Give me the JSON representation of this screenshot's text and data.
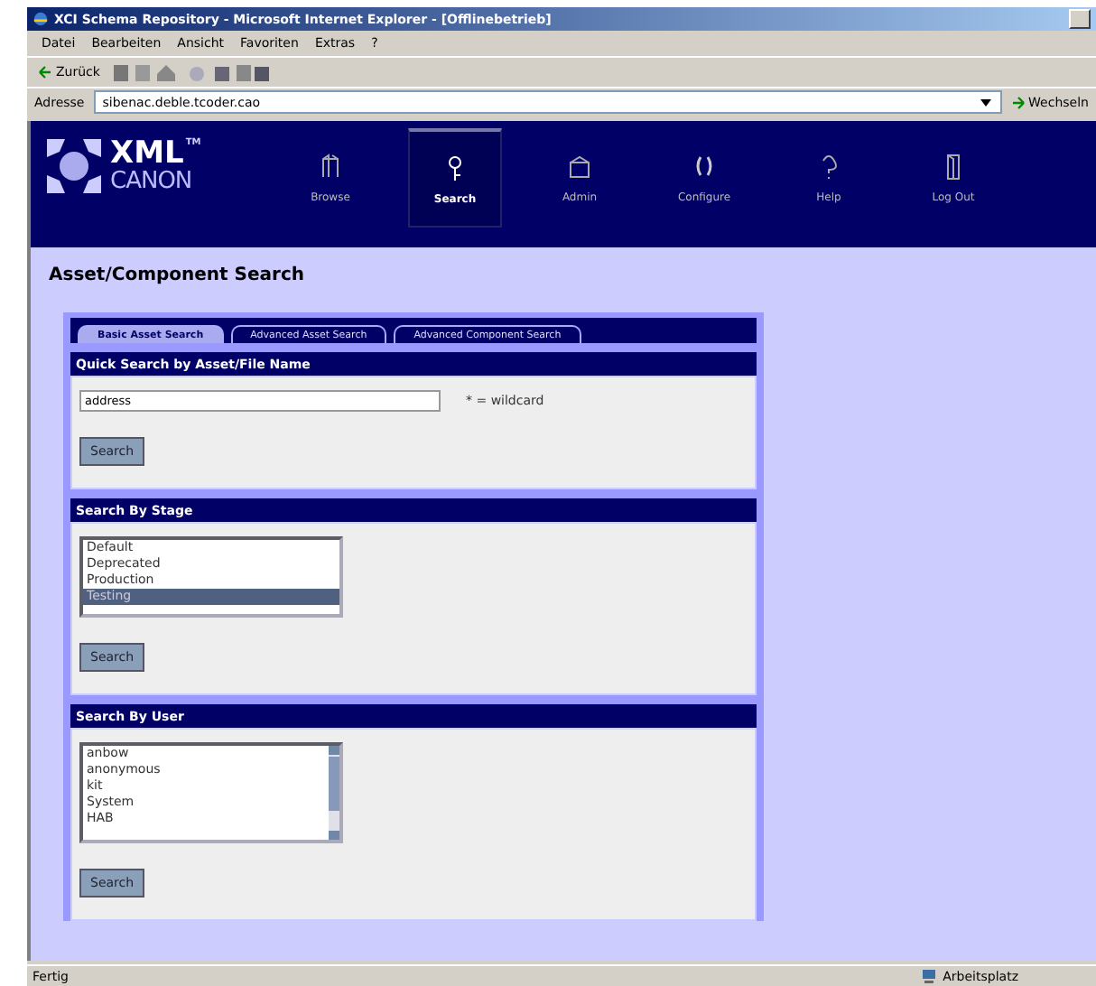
{
  "window": {
    "title": "XCI Schema Repository - Microsoft Internet Explorer - [Offlinebetrieb]"
  },
  "menu": [
    "Datei",
    "Bearbeiten",
    "Ansicht",
    "Favoriten",
    "Extras",
    "?"
  ],
  "toolbar": {
    "back": "Zurück"
  },
  "address_bar": {
    "label": "Adresse",
    "value": "sibenac.deble.tcoder.cao",
    "go": "Wechseln"
  },
  "logo": {
    "line_1": "XML",
    "line_2": "CANON",
    "mark": "TM"
  },
  "nav": [
    {
      "label": "Browse",
      "selected": false
    },
    {
      "label": "Search",
      "selected": true
    },
    {
      "label": "Admin",
      "selected": false
    },
    {
      "label": "Configure",
      "selected": false
    },
    {
      "label": "Help",
      "selected": false
    },
    {
      "label": "Log Out",
      "selected": false
    }
  ],
  "page_title": "Asset/Component Search",
  "tabs": [
    {
      "label": "Basic Asset Search",
      "selected": true
    },
    {
      "label": "Advanced Asset Search",
      "selected": false
    },
    {
      "label": "Advanced Component Search",
      "selected": false
    }
  ],
  "sections": [
    {
      "kind": "text",
      "title": "Quick Search by Asset/File Name",
      "value": "address",
      "hint": "* = wildcard",
      "button": "Search"
    },
    {
      "kind": "list",
      "title": "Search By Stage",
      "options": [
        {
          "label": "Default",
          "selected": false
        },
        {
          "label": "Deprecated",
          "selected": false
        },
        {
          "label": "Production",
          "selected": false
        },
        {
          "label": "Testing",
          "selected": true
        }
      ],
      "button": "Search"
    },
    {
      "kind": "scrolling_list",
      "title": "Search By User",
      "options": [
        {
          "label": "anbow",
          "selected": false
        },
        {
          "label": "anonymous",
          "selected": false
        },
        {
          "label": "kit",
          "selected": false
        },
        {
          "label": "System",
          "selected": false
        },
        {
          "label": "HAB",
          "selected": false
        }
      ],
      "button": "Search"
    }
  ],
  "status_bar": {
    "text": "Fertig",
    "zone": "Arbeitsplatz"
  }
}
